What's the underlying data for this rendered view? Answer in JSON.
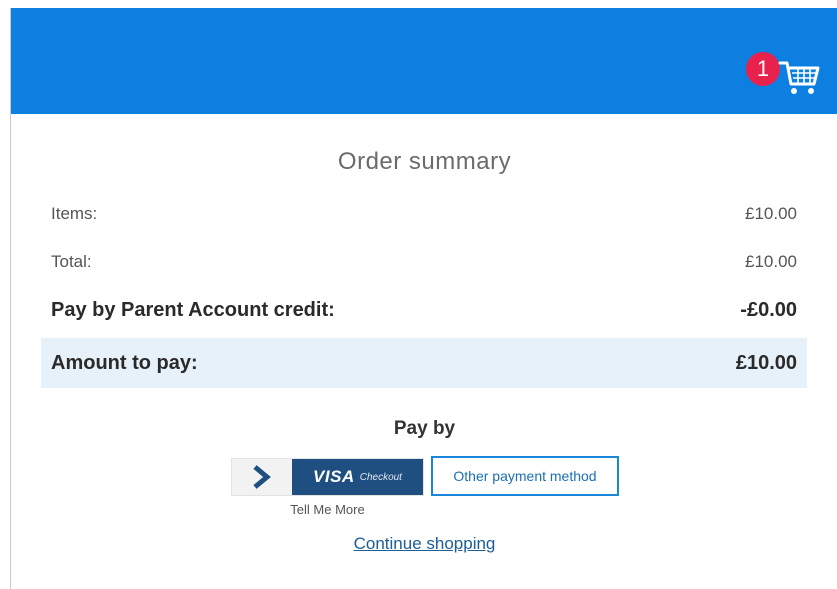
{
  "header": {
    "cart_count": "1",
    "brand_color": "#0d7fe0",
    "badge_color": "#e8214d",
    "cart_icon": "shopping-cart-icon"
  },
  "summary": {
    "title": "Order summary",
    "rows": [
      {
        "label": "Items:",
        "value": "£10.00"
      },
      {
        "label": "Total:",
        "value": "£10.00"
      },
      {
        "label": "Pay by Parent Account credit:",
        "value": "-£0.00"
      },
      {
        "label": "Amount to pay:",
        "value": "£10.00"
      }
    ]
  },
  "payment": {
    "heading": "Pay by",
    "visa_brand": "VISA",
    "visa_sub": "Checkout",
    "visa_icon": "chevron-right-icon",
    "other_label": "Other payment method",
    "tell_me_more": "Tell Me More",
    "continue_label": "Continue shopping"
  }
}
